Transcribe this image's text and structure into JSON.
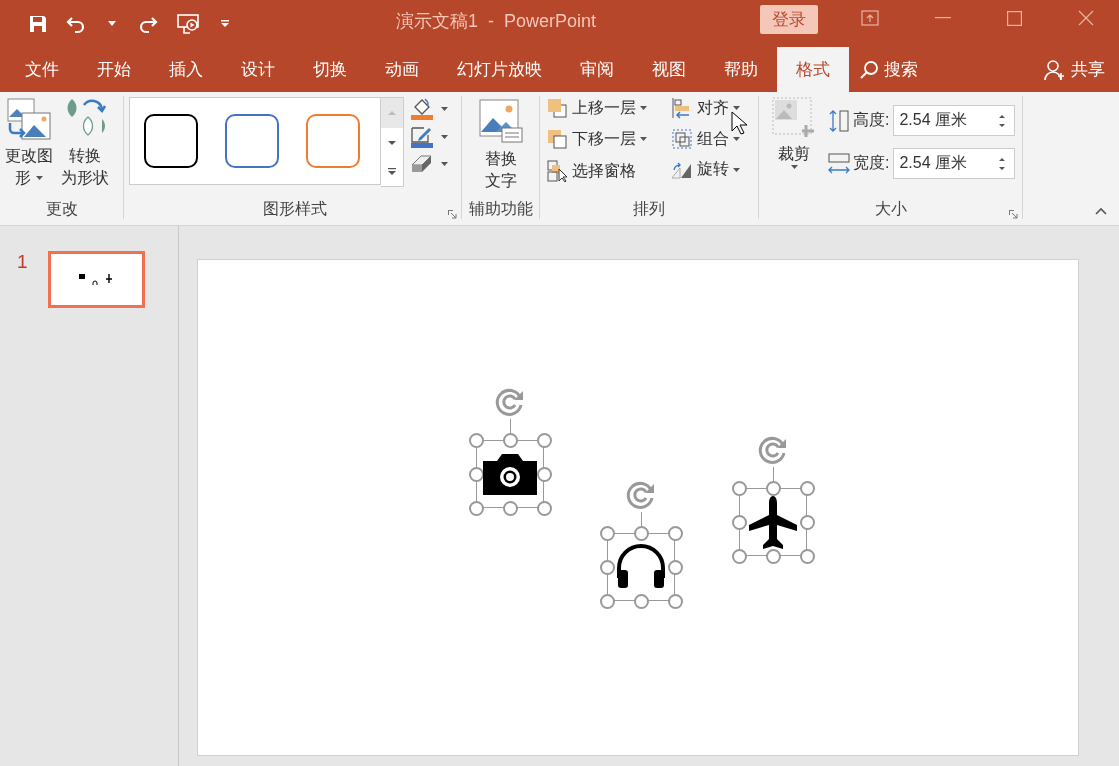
{
  "title_bar": {
    "title": "演示文稿1  -  PowerPoint",
    "login": "登录"
  },
  "tabs": [
    {
      "label": "文件",
      "selected": false
    },
    {
      "label": "开始",
      "selected": false
    },
    {
      "label": "插入",
      "selected": false
    },
    {
      "label": "设计",
      "selected": false
    },
    {
      "label": "切换",
      "selected": false
    },
    {
      "label": "动画",
      "selected": false
    },
    {
      "label": "幻灯片放映",
      "selected": false
    },
    {
      "label": "审阅",
      "selected": false
    },
    {
      "label": "视图",
      "selected": false
    },
    {
      "label": "帮助",
      "selected": false
    },
    {
      "label": "格式",
      "selected": true
    }
  ],
  "search": "搜索",
  "share": "共享",
  "ribbon": {
    "change": {
      "label": "更改",
      "buttons": [
        {
          "lines": [
            "更改图",
            "形"
          ],
          "dropdown": true
        },
        {
          "lines": [
            "转换",
            "为形状"
          ],
          "dropdown": false
        }
      ]
    },
    "shape_styles": {
      "label": "图形样式",
      "styles": [
        {
          "color": "#000000"
        },
        {
          "color": "#4472c4"
        },
        {
          "color": "#ed7d31"
        }
      ]
    },
    "accessibility": {
      "label": "辅助功能",
      "button": [
        "替换",
        "文字"
      ]
    },
    "arrange": {
      "label": "排列",
      "items": [
        {
          "label": "上移一层",
          "dropdown": true
        },
        {
          "label": "下移一层",
          "dropdown": true
        },
        {
          "label": "选择窗格",
          "dropdown": false
        },
        {
          "label": "对齐",
          "dropdown": true
        },
        {
          "label": "组合",
          "dropdown": true
        },
        {
          "label": "旋转",
          "dropdown": true
        }
      ]
    },
    "size": {
      "label": "大小",
      "crop": "裁剪",
      "fields": [
        {
          "label": "高度:",
          "value": "2.54 厘米"
        },
        {
          "label": "宽度:",
          "value": "2.54 厘米"
        }
      ]
    }
  },
  "slides": [
    {
      "number": "1",
      "selected": true
    }
  ],
  "slide_objects": [
    {
      "kind": "camera",
      "selected": true
    },
    {
      "kind": "headphones",
      "selected": true
    },
    {
      "kind": "airplane",
      "selected": true
    }
  ]
}
